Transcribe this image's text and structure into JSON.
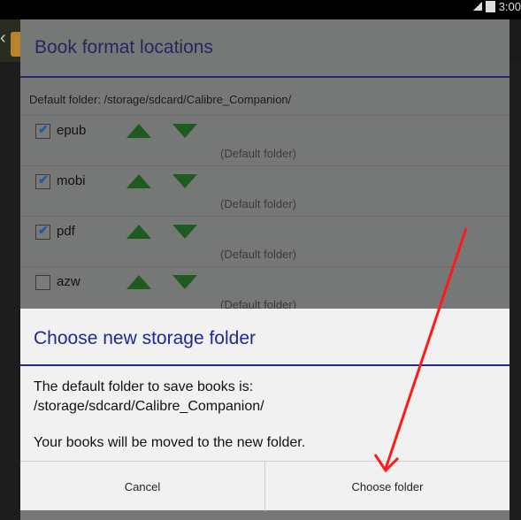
{
  "status_bar": {
    "time": "3:00"
  },
  "background_dialog": {
    "title": "Book format locations",
    "default_folder": "Default folder:  /storage/sdcard/Calibre_Companion/",
    "formats": [
      {
        "label": "epub",
        "checked": true,
        "hint": "(Default folder)"
      },
      {
        "label": "mobi",
        "checked": true,
        "hint": "(Default folder)"
      },
      {
        "label": "pdf",
        "checked": true,
        "hint": "(Default folder)"
      },
      {
        "label": "azw",
        "checked": false,
        "hint": "(Default folder)"
      }
    ]
  },
  "dialog": {
    "title": "Choose new storage folder",
    "line1": "The default folder to save books is:",
    "line2": "/storage/sdcard/Calibre_Companion/",
    "line3": "Your books will be moved to the new folder.",
    "cancel_label": "Cancel",
    "confirm_label": "Choose folder"
  },
  "colors": {
    "annotation_arrow": "#ff1a1a",
    "accent_blue": "#21279a",
    "arrow_green": "#1f5a1e"
  }
}
